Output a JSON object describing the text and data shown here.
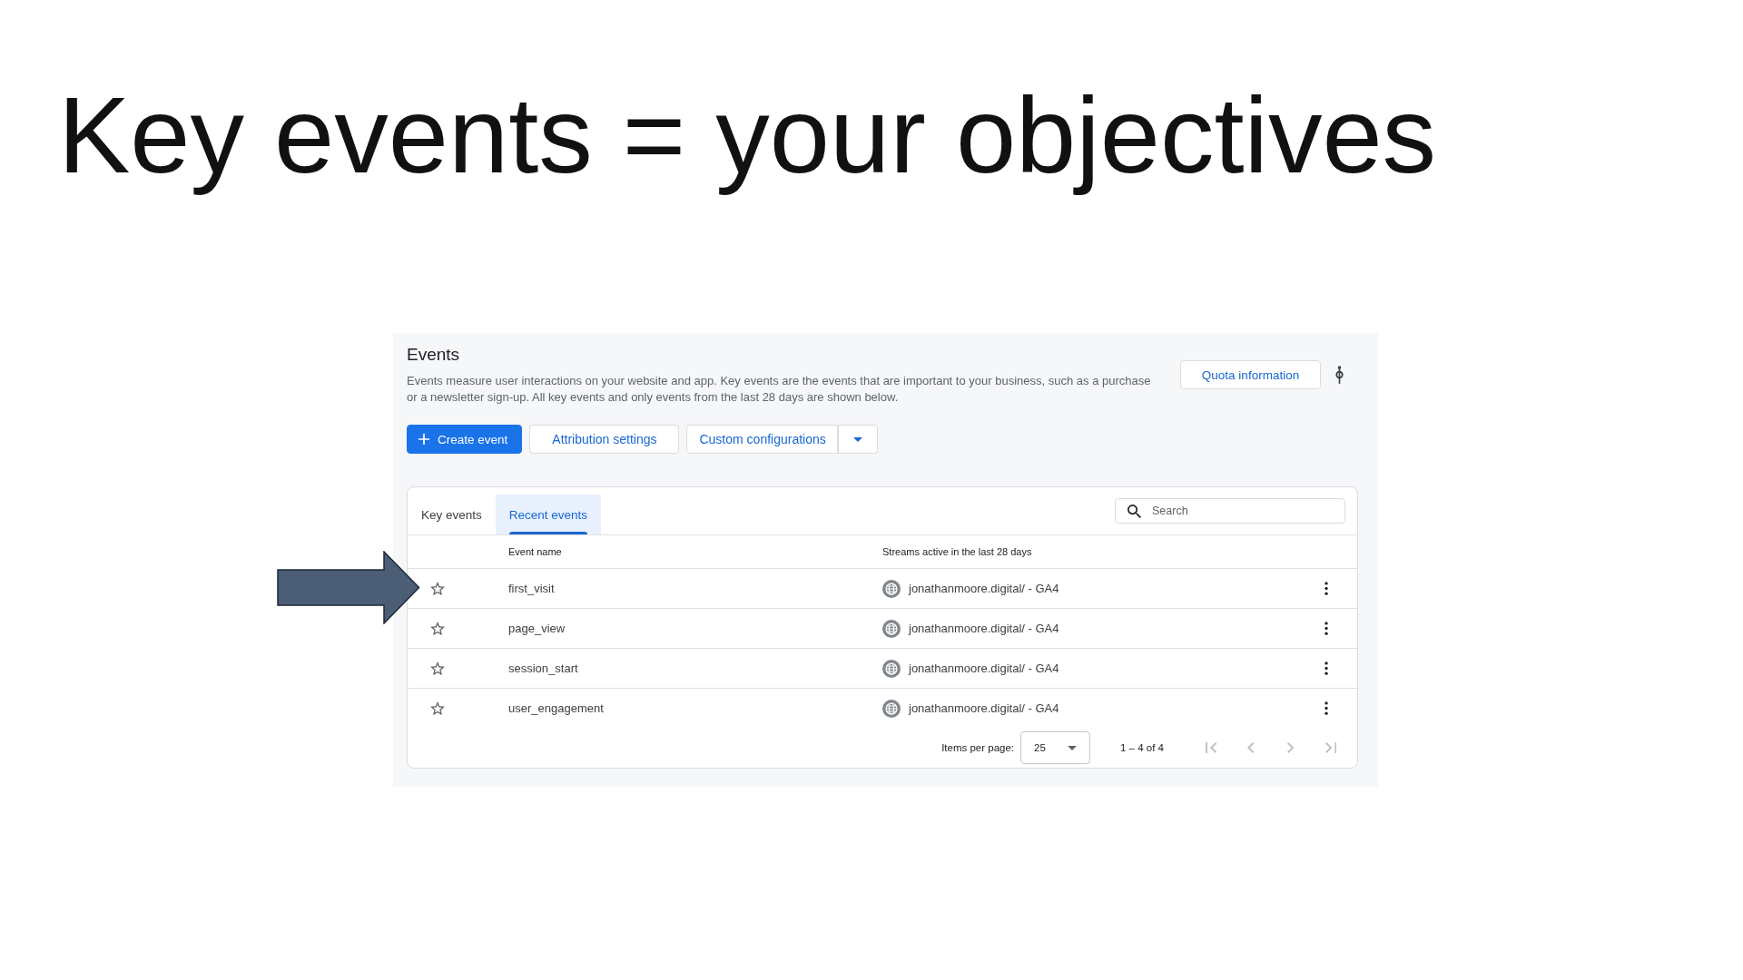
{
  "slide": {
    "title": "Key events = your objectives"
  },
  "pointer_arrow": true,
  "panel": {
    "title": "Events",
    "description": "Events measure user interactions on your website and app. Key events are the events that are important to your business, such as a purchase or a newsletter sign-up. All key events and only events from the last 28 days are shown below.",
    "quota_button": "Quota information"
  },
  "actions": [
    {
      "label": "Create event",
      "kind": "primary"
    },
    {
      "label": "Attribution settings",
      "kind": "outlined"
    },
    {
      "label": "Custom configurations",
      "kind": "split"
    }
  ],
  "tabs": [
    {
      "label": "Key events",
      "selected": false
    },
    {
      "label": "Recent events",
      "selected": true
    }
  ],
  "search": {
    "placeholder": "Search"
  },
  "table": {
    "columns": [
      "Event name",
      "Streams active in the last 28 days"
    ],
    "rows": [
      {
        "key_event": false,
        "event_name": "first_visit",
        "stream": "jonathanmoore.digital/ - GA4"
      },
      {
        "key_event": false,
        "event_name": "page_view",
        "stream": "jonathanmoore.digital/ - GA4"
      },
      {
        "key_event": false,
        "event_name": "session_start",
        "stream": "jonathanmoore.digital/ - GA4"
      },
      {
        "key_event": false,
        "event_name": "user_engagement",
        "stream": "jonathanmoore.digital/ - GA4"
      }
    ]
  },
  "pagination": {
    "items_per_page_label": "Items per page:",
    "items_per_page": "25",
    "range": "1 – 4 of 4",
    "nav": [
      {
        "kind": "first",
        "disabled": true
      },
      {
        "kind": "prev",
        "disabled": true
      },
      {
        "kind": "next",
        "disabled": true
      },
      {
        "kind": "last",
        "disabled": true
      }
    ]
  }
}
